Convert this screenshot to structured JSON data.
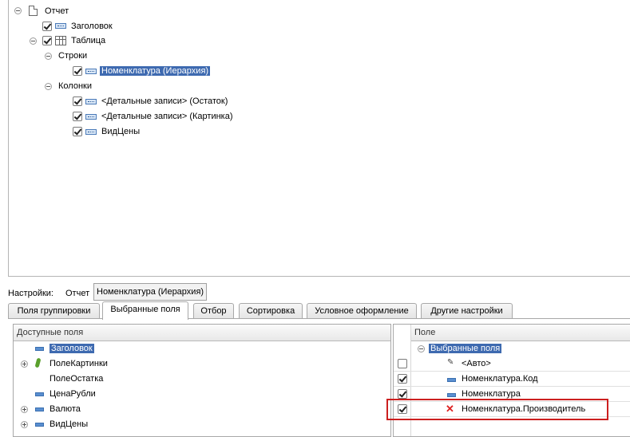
{
  "tree": {
    "root": "Отчет",
    "header_item": "Заголовок",
    "table_item": "Таблица",
    "rows_group": "Строки",
    "rows_item": "Номенклатура (Иерархия)",
    "cols_group": "Колонки",
    "col_items": [
      "<Детальные записи> (Остаток)",
      "<Детальные записи> (Картинка)",
      "ВидЦены"
    ]
  },
  "settings": {
    "label": "Настройки:",
    "path_1": "Отчет",
    "path_2": "Номенклатура (Иерархия)"
  },
  "tabs": [
    "Поля группировки",
    "Выбранные поля",
    "Отбор",
    "Сортировка",
    "Условное оформление",
    "Другие настройки"
  ],
  "available": {
    "header": "Доступные поля",
    "items": [
      "Заголовок",
      "ПолеКартинки",
      "ПолеОстатка",
      "ЦенаРубли",
      "Валюта",
      "ВидЦены"
    ]
  },
  "selected": {
    "header": "Поле",
    "group": "Выбранные поля",
    "rows": [
      "<Авто>",
      "Номенклатура.Код",
      "Номенклатура",
      "Номенклатура.Производитель"
    ]
  },
  "colors": {
    "selection": "#3e6ab0",
    "highlight_border": "#cc1f1f"
  }
}
